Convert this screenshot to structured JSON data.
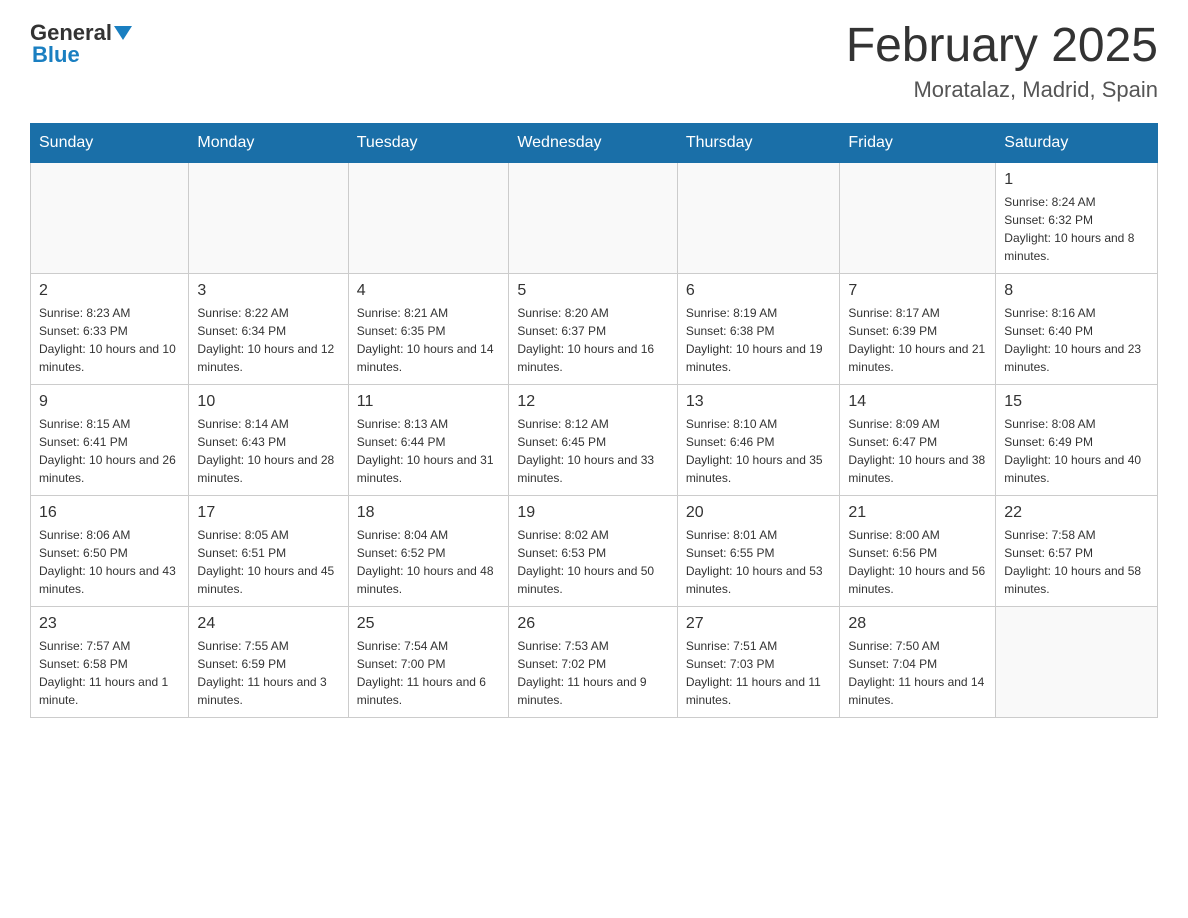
{
  "header": {
    "logo_general": "General",
    "logo_blue": "Blue",
    "month_title": "February 2025",
    "location": "Moratalaz, Madrid, Spain"
  },
  "days_of_week": [
    "Sunday",
    "Monday",
    "Tuesday",
    "Wednesday",
    "Thursday",
    "Friday",
    "Saturday"
  ],
  "weeks": [
    [
      {
        "day": "",
        "info": ""
      },
      {
        "day": "",
        "info": ""
      },
      {
        "day": "",
        "info": ""
      },
      {
        "day": "",
        "info": ""
      },
      {
        "day": "",
        "info": ""
      },
      {
        "day": "",
        "info": ""
      },
      {
        "day": "1",
        "info": "Sunrise: 8:24 AM\nSunset: 6:32 PM\nDaylight: 10 hours and 8 minutes."
      }
    ],
    [
      {
        "day": "2",
        "info": "Sunrise: 8:23 AM\nSunset: 6:33 PM\nDaylight: 10 hours and 10 minutes."
      },
      {
        "day": "3",
        "info": "Sunrise: 8:22 AM\nSunset: 6:34 PM\nDaylight: 10 hours and 12 minutes."
      },
      {
        "day": "4",
        "info": "Sunrise: 8:21 AM\nSunset: 6:35 PM\nDaylight: 10 hours and 14 minutes."
      },
      {
        "day": "5",
        "info": "Sunrise: 8:20 AM\nSunset: 6:37 PM\nDaylight: 10 hours and 16 minutes."
      },
      {
        "day": "6",
        "info": "Sunrise: 8:19 AM\nSunset: 6:38 PM\nDaylight: 10 hours and 19 minutes."
      },
      {
        "day": "7",
        "info": "Sunrise: 8:17 AM\nSunset: 6:39 PM\nDaylight: 10 hours and 21 minutes."
      },
      {
        "day": "8",
        "info": "Sunrise: 8:16 AM\nSunset: 6:40 PM\nDaylight: 10 hours and 23 minutes."
      }
    ],
    [
      {
        "day": "9",
        "info": "Sunrise: 8:15 AM\nSunset: 6:41 PM\nDaylight: 10 hours and 26 minutes."
      },
      {
        "day": "10",
        "info": "Sunrise: 8:14 AM\nSunset: 6:43 PM\nDaylight: 10 hours and 28 minutes."
      },
      {
        "day": "11",
        "info": "Sunrise: 8:13 AM\nSunset: 6:44 PM\nDaylight: 10 hours and 31 minutes."
      },
      {
        "day": "12",
        "info": "Sunrise: 8:12 AM\nSunset: 6:45 PM\nDaylight: 10 hours and 33 minutes."
      },
      {
        "day": "13",
        "info": "Sunrise: 8:10 AM\nSunset: 6:46 PM\nDaylight: 10 hours and 35 minutes."
      },
      {
        "day": "14",
        "info": "Sunrise: 8:09 AM\nSunset: 6:47 PM\nDaylight: 10 hours and 38 minutes."
      },
      {
        "day": "15",
        "info": "Sunrise: 8:08 AM\nSunset: 6:49 PM\nDaylight: 10 hours and 40 minutes."
      }
    ],
    [
      {
        "day": "16",
        "info": "Sunrise: 8:06 AM\nSunset: 6:50 PM\nDaylight: 10 hours and 43 minutes."
      },
      {
        "day": "17",
        "info": "Sunrise: 8:05 AM\nSunset: 6:51 PM\nDaylight: 10 hours and 45 minutes."
      },
      {
        "day": "18",
        "info": "Sunrise: 8:04 AM\nSunset: 6:52 PM\nDaylight: 10 hours and 48 minutes."
      },
      {
        "day": "19",
        "info": "Sunrise: 8:02 AM\nSunset: 6:53 PM\nDaylight: 10 hours and 50 minutes."
      },
      {
        "day": "20",
        "info": "Sunrise: 8:01 AM\nSunset: 6:55 PM\nDaylight: 10 hours and 53 minutes."
      },
      {
        "day": "21",
        "info": "Sunrise: 8:00 AM\nSunset: 6:56 PM\nDaylight: 10 hours and 56 minutes."
      },
      {
        "day": "22",
        "info": "Sunrise: 7:58 AM\nSunset: 6:57 PM\nDaylight: 10 hours and 58 minutes."
      }
    ],
    [
      {
        "day": "23",
        "info": "Sunrise: 7:57 AM\nSunset: 6:58 PM\nDaylight: 11 hours and 1 minute."
      },
      {
        "day": "24",
        "info": "Sunrise: 7:55 AM\nSunset: 6:59 PM\nDaylight: 11 hours and 3 minutes."
      },
      {
        "day": "25",
        "info": "Sunrise: 7:54 AM\nSunset: 7:00 PM\nDaylight: 11 hours and 6 minutes."
      },
      {
        "day": "26",
        "info": "Sunrise: 7:53 AM\nSunset: 7:02 PM\nDaylight: 11 hours and 9 minutes."
      },
      {
        "day": "27",
        "info": "Sunrise: 7:51 AM\nSunset: 7:03 PM\nDaylight: 11 hours and 11 minutes."
      },
      {
        "day": "28",
        "info": "Sunrise: 7:50 AM\nSunset: 7:04 PM\nDaylight: 11 hours and 14 minutes."
      },
      {
        "day": "",
        "info": ""
      }
    ]
  ]
}
